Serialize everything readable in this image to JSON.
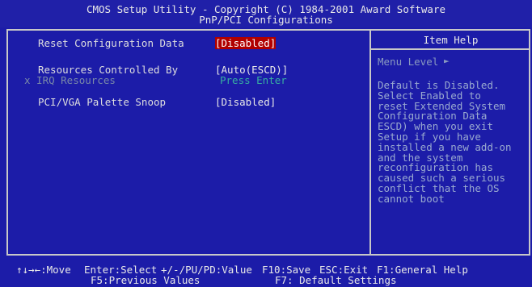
{
  "header": {
    "line1": "CMOS Setup Utility - Copyright (C) 1984-2001 Award Software",
    "line2": "PnP/PCI Configurations"
  },
  "settings": [
    {
      "label": "Reset Configuration Data",
      "value": "[Disabled]",
      "selected": true
    },
    {
      "label": "Resources Controlled By",
      "value": "[Auto(ESCD)]",
      "selected": false
    },
    {
      "label": "x IRQ Resources",
      "value": "Press Enter",
      "disabled": true
    },
    {
      "label": "PCI/VGA Palette Snoop",
      "value": "[Disabled]",
      "selected": false
    }
  ],
  "help": {
    "title": "Item Help",
    "menu_level_label": "Menu Level",
    "menu_level_icon": "right-triangle-icon",
    "lines": [
      "Default is Disabled.",
      "Select Enabled to",
      "reset Extended System",
      "Configuration Data",
      "ESCD) when you exit",
      "Setup if you have",
      "installed a new add-on",
      "and the system",
      "reconfiguration has",
      "caused such a serious",
      "conflict that the OS",
      "cannot boot"
    ]
  },
  "footer": {
    "line1": {
      "move": "↑↓→←:Move",
      "enter": "Enter:Select",
      "value": "+/-/PU/PD:Value",
      "save": "F10:Save",
      "exit": "ESC:Exit",
      "help": "F1:General Help"
    },
    "line2": {
      "prev": "F5:Previous Values",
      "defaults": "F7: Default Settings"
    }
  },
  "colors": {
    "background": "#1c1ca8",
    "selection": "#b00000",
    "help_text": "#9aaad0",
    "disabled_item": "#7a8aa8",
    "press_enter": "#38b0a0"
  }
}
